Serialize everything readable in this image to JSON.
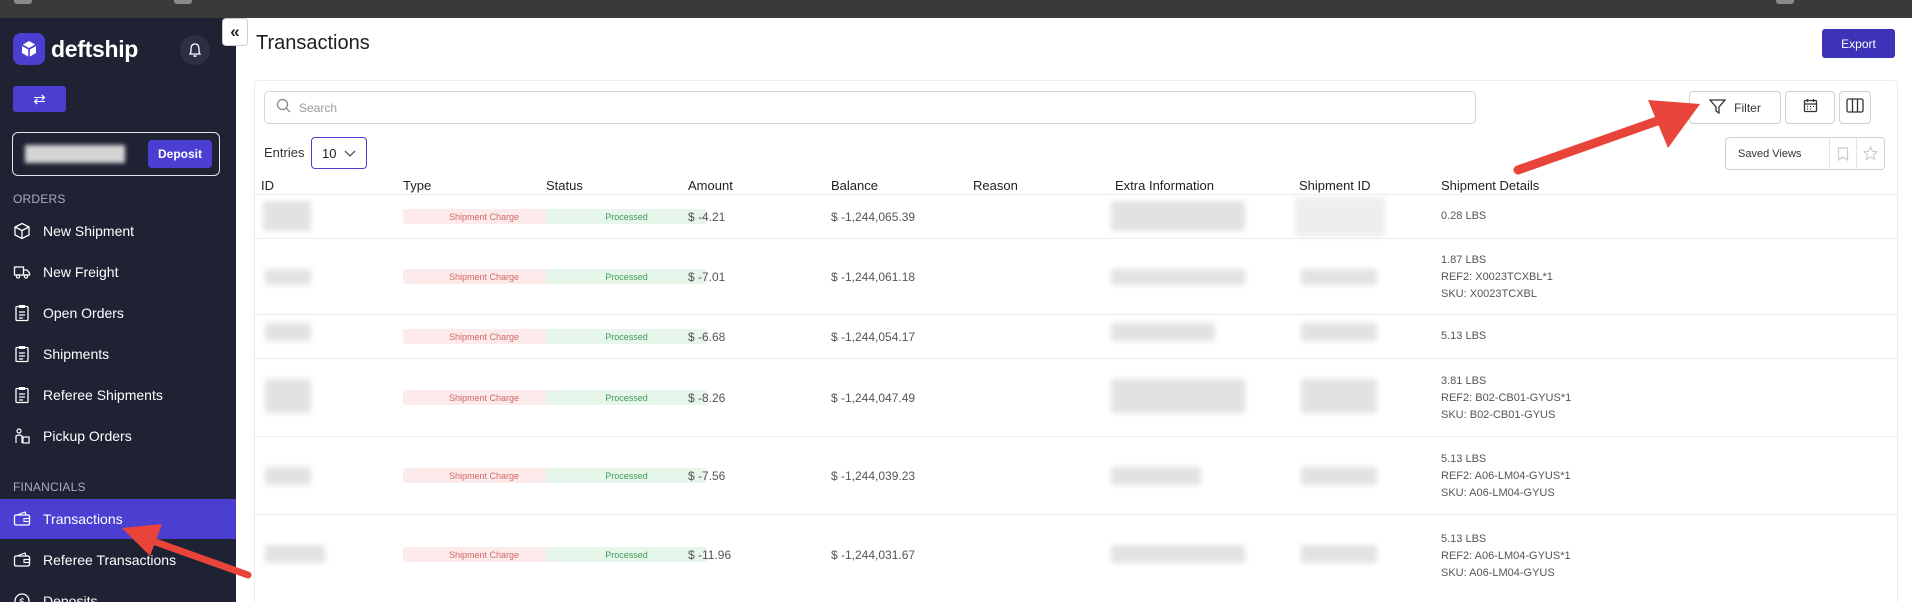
{
  "sidebar": {
    "brand": "deftship",
    "deposit_label": "Deposit",
    "sections": [
      {
        "label": "ORDERS",
        "items": [
          {
            "label": "New Shipment",
            "icon": "box-icon"
          },
          {
            "label": "New Freight",
            "icon": "truck-icon"
          },
          {
            "label": "Open Orders",
            "icon": "clipboard-icon"
          },
          {
            "label": "Shipments",
            "icon": "clipboard-icon"
          },
          {
            "label": "Referee Shipments",
            "icon": "clipboard-icon"
          },
          {
            "label": "Pickup Orders",
            "icon": "person-box-icon"
          }
        ]
      },
      {
        "label": "FINANCIALS",
        "items": [
          {
            "label": "Transactions",
            "icon": "wallet-icon",
            "active": true
          },
          {
            "label": "Referee Transactions",
            "icon": "wallet-icon"
          },
          {
            "label": "Deposits",
            "icon": "dollar-icon"
          }
        ]
      }
    ]
  },
  "header": {
    "title": "Transactions",
    "export_label": "Export"
  },
  "toolbar": {
    "search_placeholder": "Search",
    "filter_label": "Filter",
    "entries_label": "Entries",
    "entries_value": "10",
    "saved_views_label": "Saved Views"
  },
  "table": {
    "columns": [
      "ID",
      "Type",
      "Status",
      "Amount",
      "Balance",
      "Reason",
      "Extra Information",
      "Shipment ID",
      "Shipment Details"
    ],
    "rows": [
      {
        "type": "Shipment Charge",
        "status": "Processed",
        "amount": "$ -4.21",
        "balance": "$ -1,244,065.39",
        "reason": "",
        "details": [
          "0.28 LBS"
        ]
      },
      {
        "type": "Shipment Charge",
        "status": "Processed",
        "amount": "$ -7.01",
        "balance": "$ -1,244,061.18",
        "reason": "",
        "details": [
          "1.87 LBS",
          "REF2: X0023TCXBL*1",
          "SKU: X0023TCXBL"
        ]
      },
      {
        "type": "Shipment Charge",
        "status": "Processed",
        "amount": "$ -6.68",
        "balance": "$ -1,244,054.17",
        "reason": "",
        "details": [
          "5.13 LBS"
        ]
      },
      {
        "type": "Shipment Charge",
        "status": "Processed",
        "amount": "$ -8.26",
        "balance": "$ -1,244,047.49",
        "reason": "",
        "details": [
          "3.81 LBS",
          "REF2: B02-CB01-GYUS*1",
          "SKU: B02-CB01-GYUS"
        ]
      },
      {
        "type": "Shipment Charge",
        "status": "Processed",
        "amount": "$ -7.56",
        "balance": "$ -1,244,039.23",
        "reason": "",
        "details": [
          "5.13 LBS",
          "REF2: A06-LM04-GYUS*1",
          "SKU: A06-LM04-GYUS"
        ]
      },
      {
        "type": "Shipment Charge",
        "status": "Processed",
        "amount": "$ -11.96",
        "balance": "$ -1,244,031.67",
        "reason": "",
        "details": [
          "5.13 LBS",
          "REF2: A06-LM04-GYUS*1",
          "SKU: A06-LM04-GYUS"
        ]
      }
    ]
  },
  "colors": {
    "accent": "#4a3fd1",
    "sidebar_bg": "#1f2233",
    "annotation_arrow": "#e8443a"
  }
}
